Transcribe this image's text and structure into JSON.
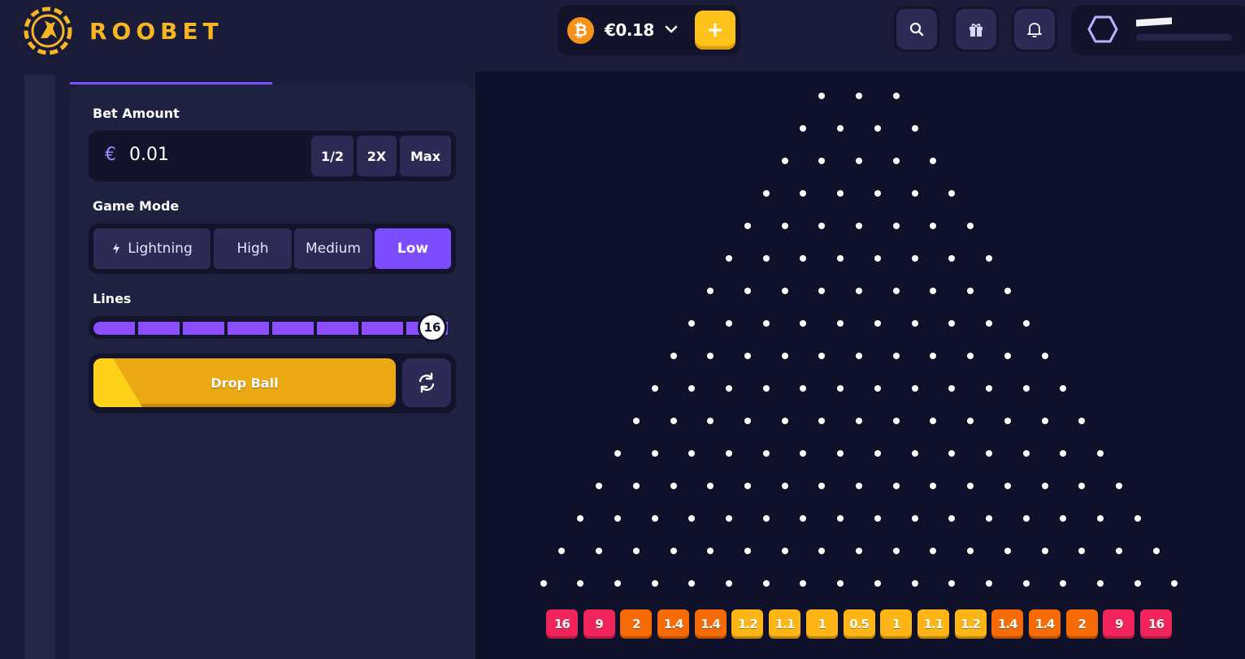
{
  "brand": {
    "name": "ROOBET",
    "logo_icon": "kangaroo-logo-icon",
    "accent": "#f5b524"
  },
  "wallet": {
    "currency_icon": "bitcoin-icon",
    "balance": "€0.18",
    "deposit_icon": "plus-icon"
  },
  "header_icons": [
    "search-icon",
    "gift-icon",
    "bell-icon"
  ],
  "profile": {
    "avatar_icon": "hexagon-icon"
  },
  "controls": {
    "bet_amount_label": "Bet Amount",
    "bet_currency_symbol": "€",
    "bet_value": "0.01",
    "bet_buttons": {
      "half": "1/2",
      "double": "2X",
      "max": "Max"
    },
    "game_mode_label": "Game Mode",
    "modes": {
      "lightning": "Lightning",
      "high": "High",
      "medium": "Medium",
      "low": "Low"
    },
    "selected_mode": "Low",
    "lines_label": "Lines",
    "lines_value": "16",
    "lines_fill_fraction": 1.0,
    "drop_button": "Drop Ball",
    "auto_icon": "refresh-icon"
  },
  "board": {
    "rows": 16,
    "multipliers": [
      "16",
      "9",
      "2",
      "1.4",
      "1.4",
      "1.2",
      "1.1",
      "1",
      "0.5",
      "1",
      "1.1",
      "1.2",
      "1.4",
      "1.4",
      "2",
      "9",
      "16"
    ],
    "bucket_colors": [
      "#f0245a",
      "#f0245a",
      "#f76b06",
      "#f76b06",
      "#f76b06",
      "#ffb515",
      "#ffb515",
      "#ffb515",
      "#ffb515",
      "#ffb515",
      "#ffb515",
      "#ffb515",
      "#f76b06",
      "#f76b06",
      "#f76b06",
      "#f0245a",
      "#f0245a"
    ]
  }
}
